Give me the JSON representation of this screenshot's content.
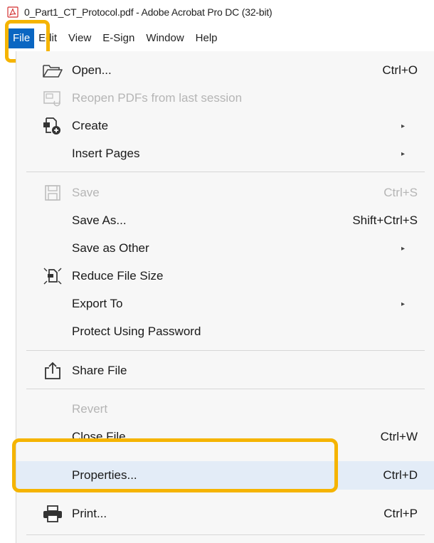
{
  "window": {
    "title": "0_Part1_CT_Protocol.pdf - Adobe Acrobat Pro DC (32-bit)"
  },
  "menubar": {
    "items": [
      {
        "label": "File"
      },
      {
        "label": "Edit"
      },
      {
        "label": "View"
      },
      {
        "label": "E-Sign"
      },
      {
        "label": "Window"
      },
      {
        "label": "Help"
      }
    ]
  },
  "file_menu": {
    "items": [
      {
        "label": "Open...",
        "shortcut": "Ctrl+O",
        "enabled": true,
        "icon": "folder-open-icon"
      },
      {
        "label": "Reopen PDFs from last session",
        "shortcut": "",
        "enabled": false,
        "icon": "reopen-icon"
      },
      {
        "label": "Create",
        "shortcut": "",
        "enabled": true,
        "submenu": true,
        "icon": "create-pdf-icon"
      },
      {
        "label": "Insert Pages",
        "shortcut": "",
        "enabled": true,
        "submenu": true
      },
      {
        "label": "Save",
        "shortcut": "Ctrl+S",
        "enabled": false,
        "icon": "save-icon"
      },
      {
        "label": "Save As...",
        "shortcut": "Shift+Ctrl+S",
        "enabled": true
      },
      {
        "label": "Save as Other",
        "shortcut": "",
        "enabled": true,
        "submenu": true
      },
      {
        "label": "Reduce File Size",
        "shortcut": "",
        "enabled": true,
        "icon": "reduce-size-icon"
      },
      {
        "label": "Export To",
        "shortcut": "",
        "enabled": true,
        "submenu": true
      },
      {
        "label": "Protect Using Password",
        "shortcut": "",
        "enabled": true
      },
      {
        "label": "Share File",
        "shortcut": "",
        "enabled": true,
        "icon": "share-icon"
      },
      {
        "label": "Revert",
        "shortcut": "",
        "enabled": false
      },
      {
        "label": "Close File",
        "shortcut": "Ctrl+W",
        "enabled": true
      },
      {
        "label": "Properties...",
        "shortcut": "Ctrl+D",
        "enabled": true,
        "highlighted": true
      },
      {
        "label": "Print...",
        "shortcut": "Ctrl+P",
        "enabled": true,
        "icon": "printer-icon"
      }
    ]
  },
  "colors": {
    "file_menu_active": "#0a66c2",
    "highlight_outline": "#f5b400",
    "hover_row": "#e3ecf7",
    "disabled_text": "#b5b5b5"
  }
}
